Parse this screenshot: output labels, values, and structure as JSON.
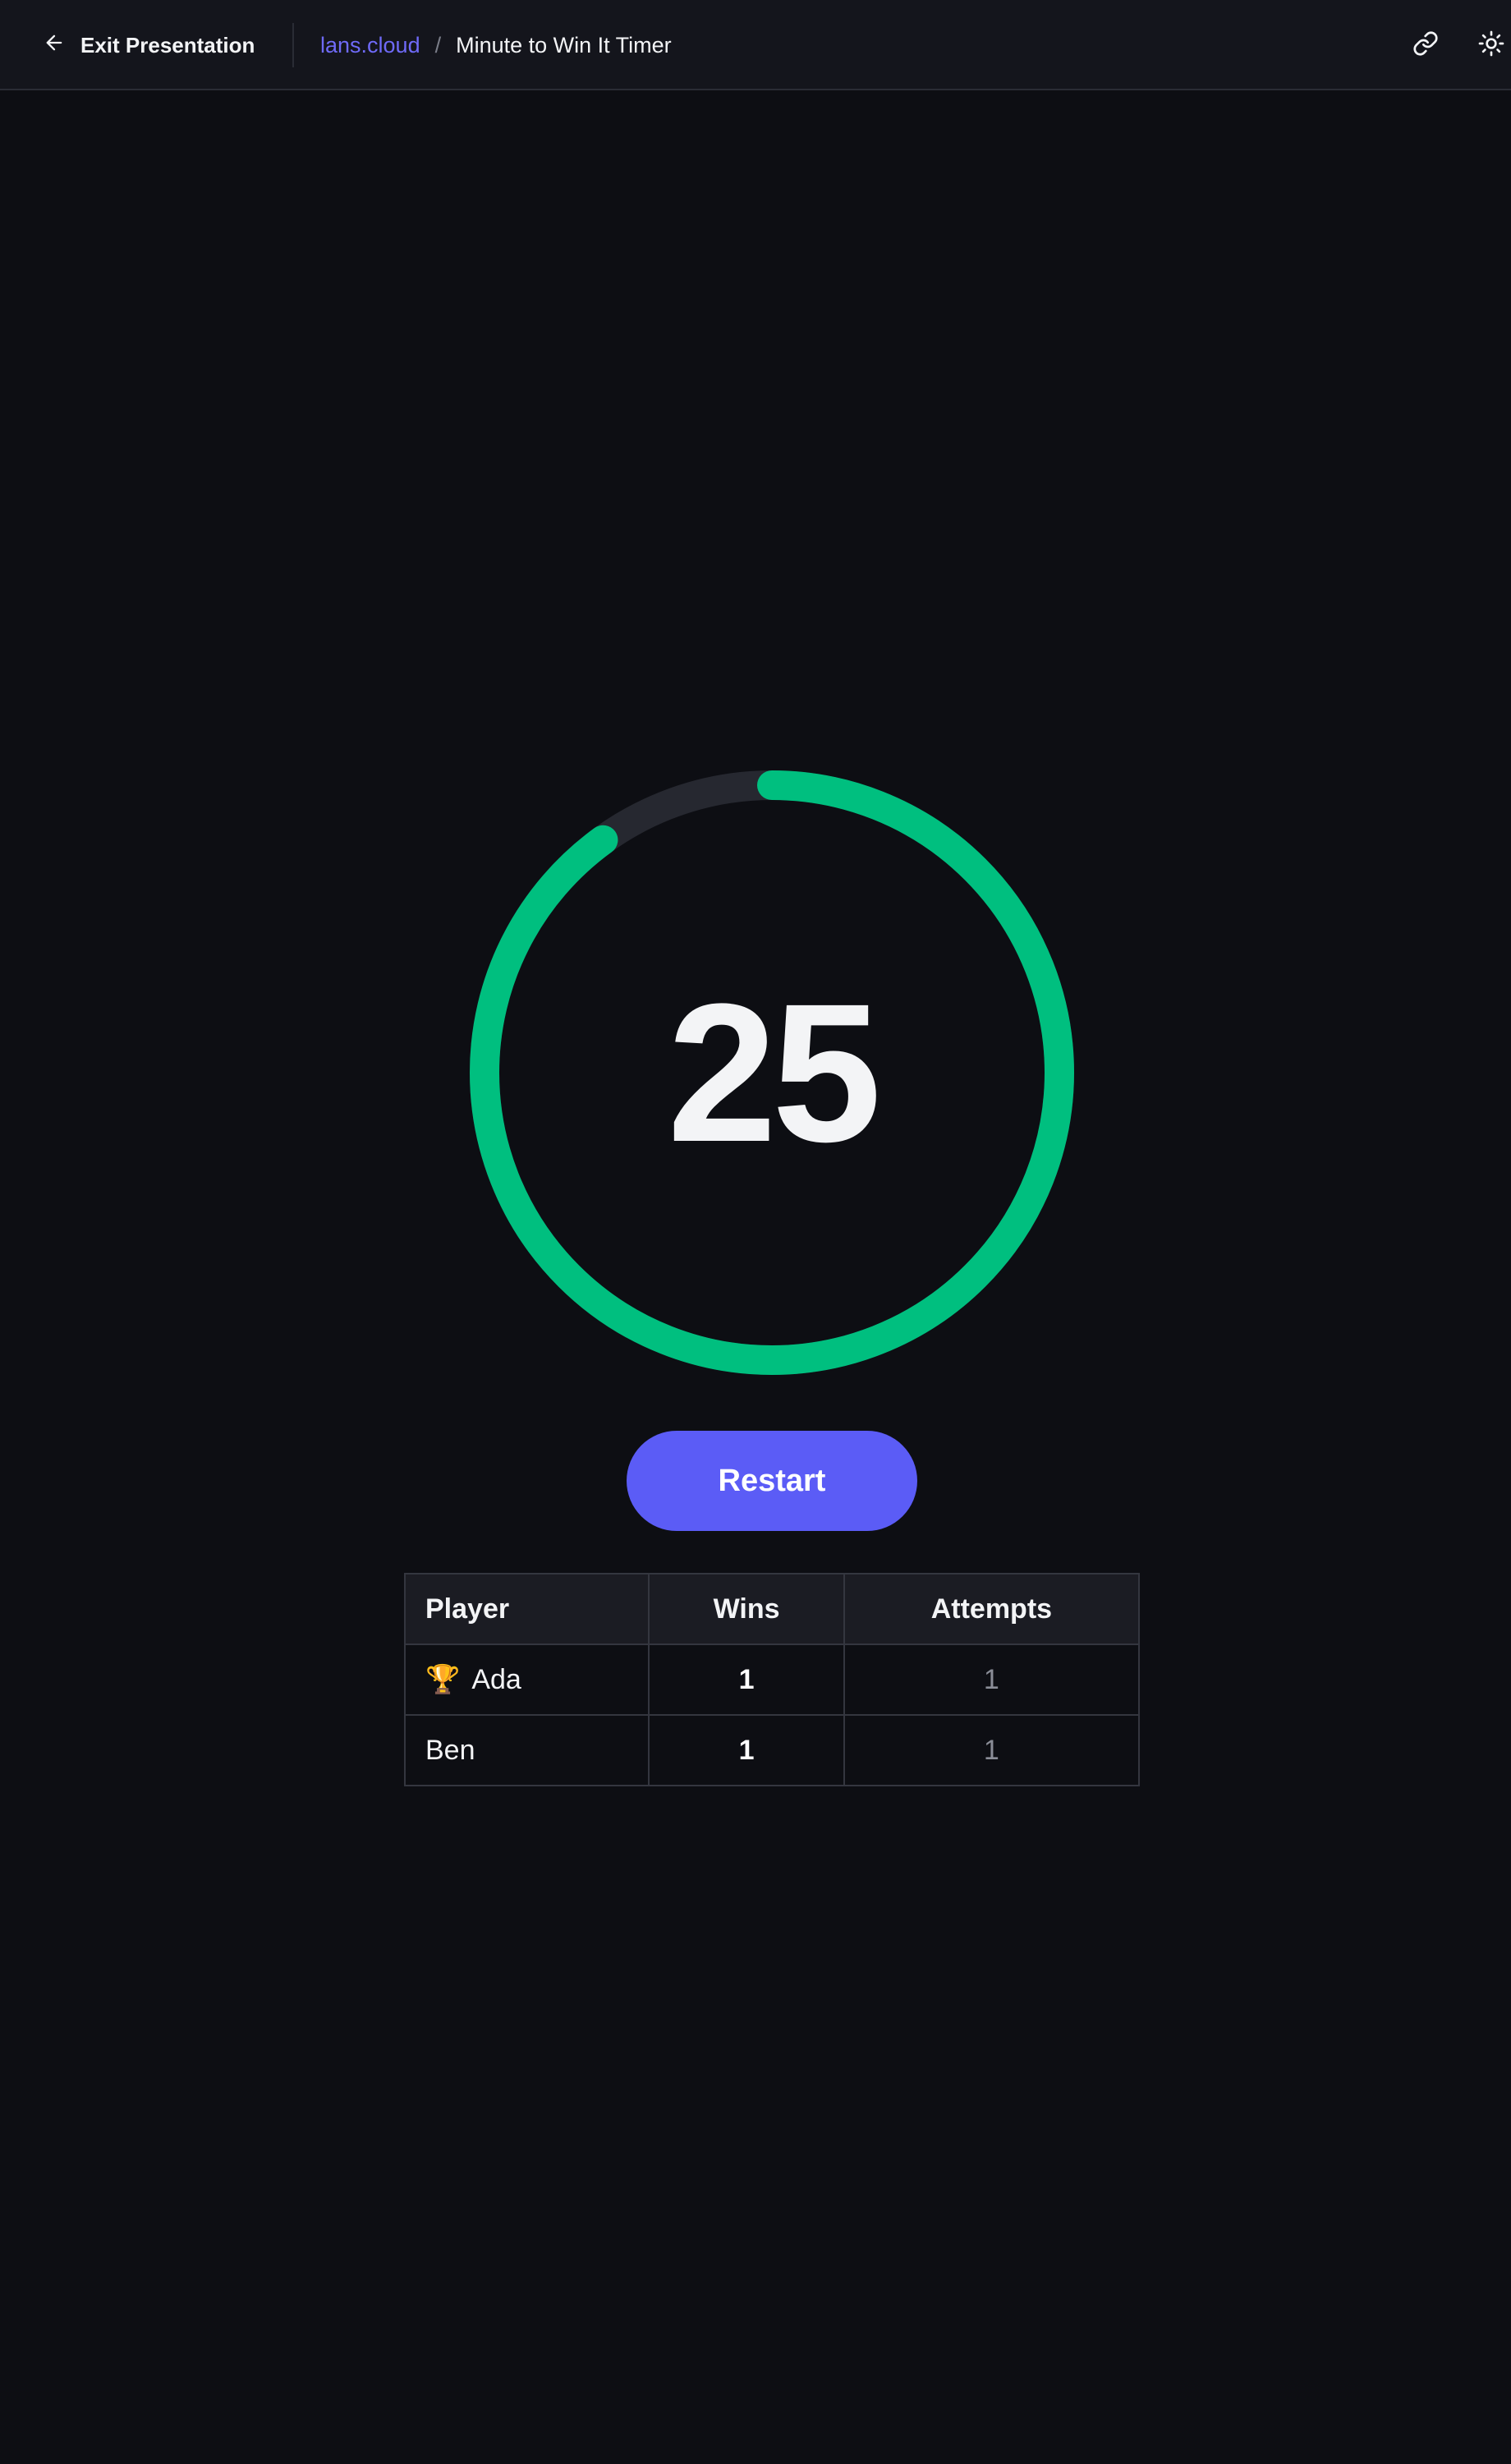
{
  "header": {
    "exit_label": "Exit Presentation",
    "breadcrumb_site": "lans.cloud",
    "breadcrumb_separator": "/",
    "breadcrumb_current": "Minute to Win It Timer",
    "link_icon": "link-icon",
    "theme_icon": "sun-icon"
  },
  "timer": {
    "value": "25",
    "progress_remaining": 0.9,
    "ring_color": "#00bf7f",
    "track_color": "#262830"
  },
  "actions": {
    "restart_label": "Restart"
  },
  "scoreboard": {
    "columns": [
      "Player",
      "Wins",
      "Attempts"
    ],
    "rows": [
      {
        "player": "Ada",
        "badge": "🏆",
        "wins": "1",
        "attempts": "1"
      },
      {
        "player": "Ben",
        "badge": "",
        "wins": "1",
        "attempts": "1"
      }
    ]
  },
  "colors": {
    "accent": "#5b5cf6",
    "link": "#6f6af8",
    "background": "#0d0e13"
  }
}
